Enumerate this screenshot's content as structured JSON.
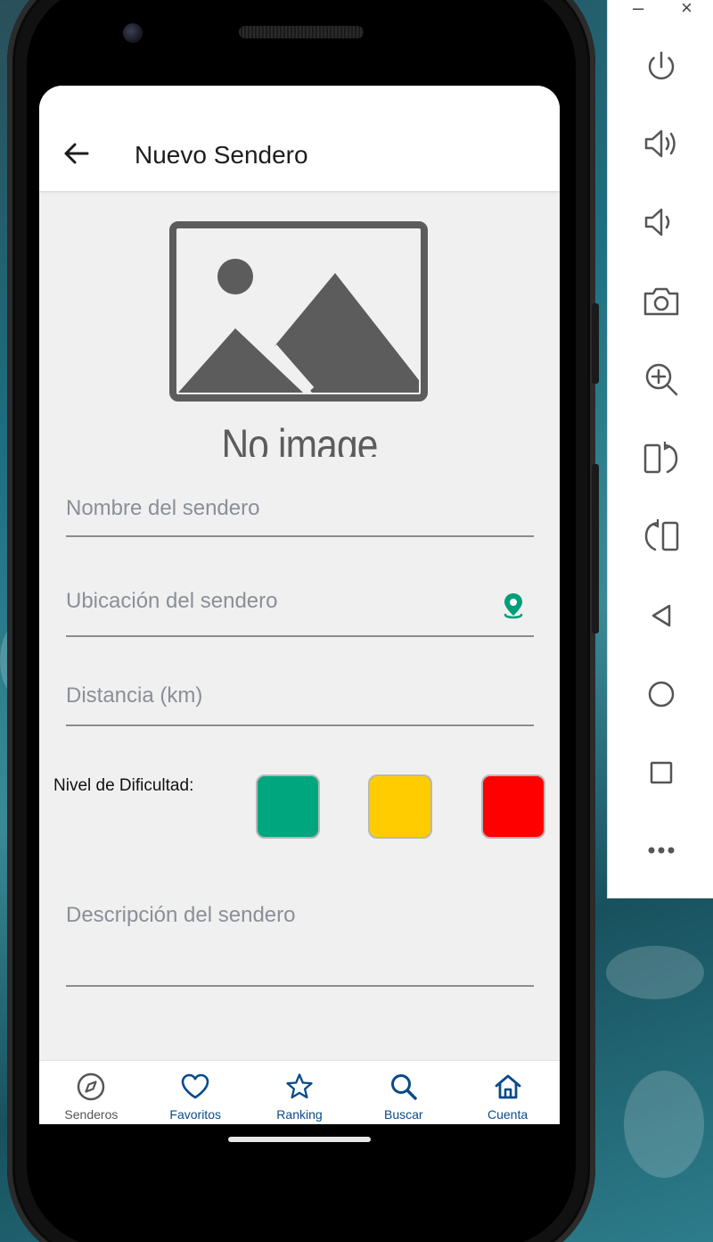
{
  "app": {
    "title": "Nuevo Sendero",
    "placeholder_image_text": "No image"
  },
  "form": {
    "name_placeholder": "Nombre del sendero",
    "location_placeholder": "Ubicación del sendero",
    "distance_placeholder": "Distancia (km)",
    "difficulty_label": "Nivel de Dificultad:",
    "difficulty_colors": [
      "#00a67e",
      "#ffcc00",
      "#ff0000"
    ],
    "description_placeholder": "Descripción del sendero"
  },
  "bottom_nav": {
    "items": [
      {
        "label": "Senderos",
        "icon": "compass-icon",
        "active": false
      },
      {
        "label": "Favoritos",
        "icon": "heart-icon",
        "active": true
      },
      {
        "label": "Ranking",
        "icon": "star-icon",
        "active": true
      },
      {
        "label": "Buscar",
        "icon": "search-icon",
        "active": true
      },
      {
        "label": "Cuenta",
        "icon": "home-icon",
        "active": true
      }
    ],
    "colors": {
      "primary": "#0a4a8a",
      "inactive": "#555555"
    }
  },
  "emulator": {
    "minimize": "–",
    "close": "×",
    "buttons": [
      "power-icon",
      "volume-up-icon",
      "volume-down-icon",
      "camera-icon",
      "zoom-in-icon",
      "rotate-right-icon",
      "rotate-left-icon",
      "back-icon",
      "home-circle-icon",
      "overview-icon",
      "more-icon"
    ]
  },
  "colors": {
    "accent": "#009e7a",
    "icon_gray": "#5c5c5c"
  }
}
